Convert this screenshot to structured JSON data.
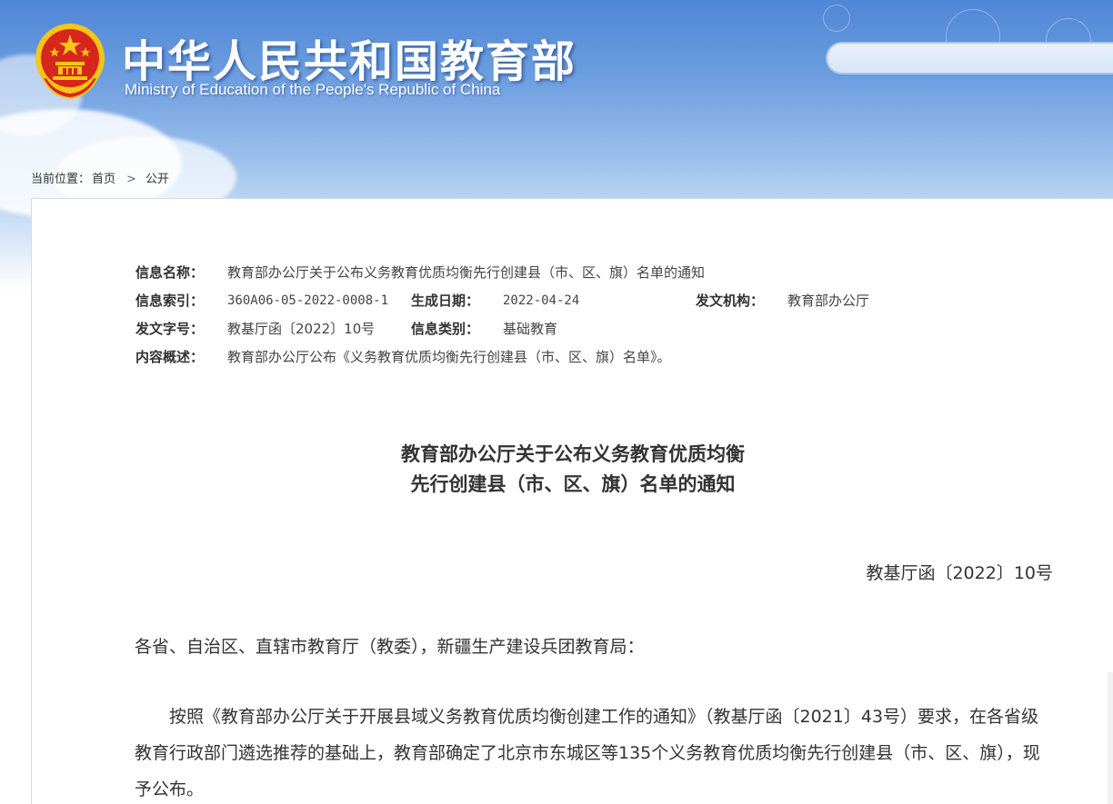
{
  "header": {
    "site_title": "中华人民共和国教育部",
    "site_subtitle": "Ministry of Education of the People's Republic of China",
    "search": {
      "placeholder": ""
    }
  },
  "breadcrumb": {
    "prefix": "当前位置：",
    "items": [
      "首页",
      "公开"
    ],
    "separator": ">"
  },
  "meta": {
    "name_label": "信息名称：",
    "name_value": "教育部办公厅关于公布义务教育优质均衡先行创建县（市、区、旗）名单的通知",
    "index_label": "信息索引：",
    "index_value": "360A06-05-2022-0008-1",
    "date_label": "生成日期：",
    "date_value": "2022-04-24",
    "org_label": "发文机构：",
    "org_value": "教育部办公厅",
    "docno_label": "发文字号：",
    "docno_value": "教基厅函〔2022〕10号",
    "category_label": "信息类别：",
    "category_value": "基础教育",
    "summary_label": "内容概述：",
    "summary_value": "教育部办公厅公布《义务教育优质均衡先行创建县（市、区、旗）名单》。"
  },
  "document": {
    "title_line1": "教育部办公厅关于公布义务教育优质均衡",
    "title_line2": "先行创建县（市、区、旗）名单的通知",
    "doc_number": "教基厅函〔2022〕10号",
    "salutation": "各省、自治区、直辖市教育厅（教委），新疆生产建设兵团教育局：",
    "paragraph1": "按照《教育部办公厅关于开展县域义务教育优质均衡创建工作的通知》（教基厅函〔2021〕43号）要求，在各省级教育行政部门遴选推荐的基础上，教育部确定了北京市东城区等135个义务教育优质均衡先行创建县（市、区、旗），现予公布。"
  },
  "colors": {
    "sky_top": "#4f86d6",
    "text": "#333333",
    "emblem_red": "#d7261c",
    "emblem_gold": "#f5c518"
  }
}
